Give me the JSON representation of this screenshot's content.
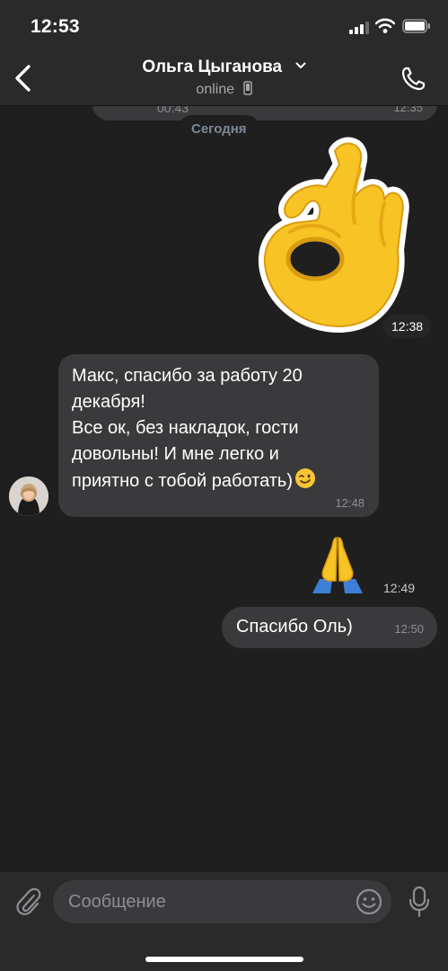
{
  "status_bar": {
    "time": "12:53"
  },
  "header": {
    "title": "Ольга Цыганова",
    "subtitle": "online"
  },
  "messages": {
    "previous": {
      "duration": "00:43",
      "time": "12:35"
    },
    "date_separator": "Сегодня",
    "sticker": {
      "emoji": "ok-hand",
      "time": "12:38"
    },
    "incoming": {
      "lines": [
        "Макс, спасибо за работу 20",
        "декабря!",
        "Все ок, без накладок, гости",
        "довольны! И мне легко и",
        "приятно с тобой работать)"
      ],
      "time": "12:48"
    },
    "pray": {
      "emoji": "folded-hands",
      "time": "12:49"
    },
    "outgoing": {
      "text": "Спасибо Оль)",
      "time": "12:50"
    }
  },
  "composer": {
    "placeholder": "Сообщение"
  },
  "colors": {
    "background": "#1f1f1f",
    "bar": "#2a2a2b",
    "bubble": "#3a3a3c",
    "secondary_text": "#8e8e93",
    "date_text": "#7d8796"
  }
}
